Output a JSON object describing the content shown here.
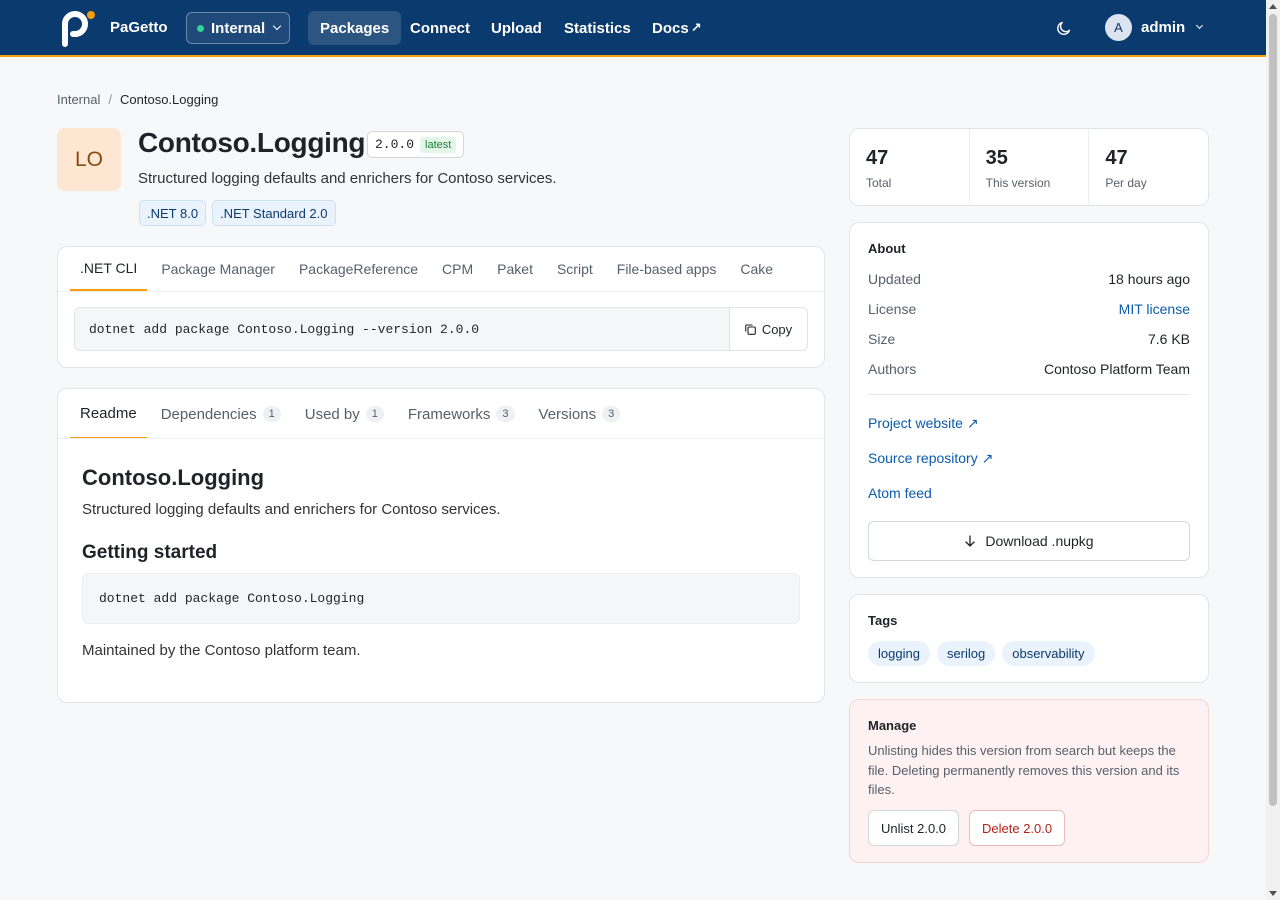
{
  "colors": {
    "navbar": "#0b3a6e",
    "accent": "#f59e0b",
    "link": "#0b5cad",
    "danger": "#b42318",
    "success_dot": "#34d399"
  },
  "navbar": {
    "brand": "PaGetto",
    "feed": "Internal",
    "links": [
      {
        "label": "Packages",
        "active": true
      },
      {
        "label": "Connect"
      },
      {
        "label": "Upload"
      },
      {
        "label": "Statistics"
      },
      {
        "label": "Docs",
        "external": true
      }
    ],
    "theme_icon": "moon-icon",
    "user": {
      "initial": "A",
      "name": "admin"
    }
  },
  "breadcrumb": {
    "parent": "Internal",
    "separator": "/",
    "current": "Contoso.Logging"
  },
  "package": {
    "icon_text": "LO",
    "title": "Contoso.Logging",
    "version": "2.0.0",
    "latest_label": "latest",
    "description": "Structured logging defaults and enrichers for Contoso services.",
    "frameworks": [
      ".NET 8.0",
      ".NET Standard 2.0"
    ]
  },
  "install": {
    "tabs": [
      ".NET CLI",
      "Package Manager",
      "PackageReference",
      "CPM",
      "Paket",
      "Script",
      "File-based apps",
      "Cake"
    ],
    "active_tab": ".NET CLI",
    "command": "dotnet add package Contoso.Logging --version 2.0.0",
    "copy_label": "Copy"
  },
  "readme_tabs": [
    {
      "label": "Readme",
      "count": null
    },
    {
      "label": "Dependencies",
      "count": "1"
    },
    {
      "label": "Used by",
      "count": "1"
    },
    {
      "label": "Frameworks",
      "count": "3"
    },
    {
      "label": "Versions",
      "count": "3"
    }
  ],
  "readme": {
    "h1": "Contoso.Logging",
    "p1": "Structured logging defaults and enrichers for Contoso services.",
    "h2": "Getting started",
    "code": "dotnet add package Contoso.Logging",
    "p2": "Maintained by the Contoso platform team."
  },
  "stats": [
    {
      "value": "47",
      "label": "Total"
    },
    {
      "value": "35",
      "label": "This version"
    },
    {
      "value": "47",
      "label": "Per day"
    }
  ],
  "about": {
    "heading": "About",
    "rows": [
      {
        "key": "Updated",
        "value": "18 hours ago"
      },
      {
        "key": "License",
        "value": "MIT license",
        "link": true
      },
      {
        "key": "Size",
        "value": "7.6 KB"
      },
      {
        "key": "Authors",
        "value": "Contoso Platform Team"
      }
    ],
    "project_website": "Project website ↗",
    "source_repository": "Source repository ↗",
    "atom_feed": "Atom feed",
    "download_label": "Download .nupkg"
  },
  "tags": {
    "heading": "Tags",
    "items": [
      "logging",
      "serilog",
      "observability"
    ]
  },
  "manage": {
    "heading": "Manage",
    "text": "Unlisting hides this version from search but keeps the file. Deleting permanently removes this version and its files.",
    "unlist_label": "Unlist 2.0.0",
    "delete_label": "Delete 2.0.0"
  }
}
